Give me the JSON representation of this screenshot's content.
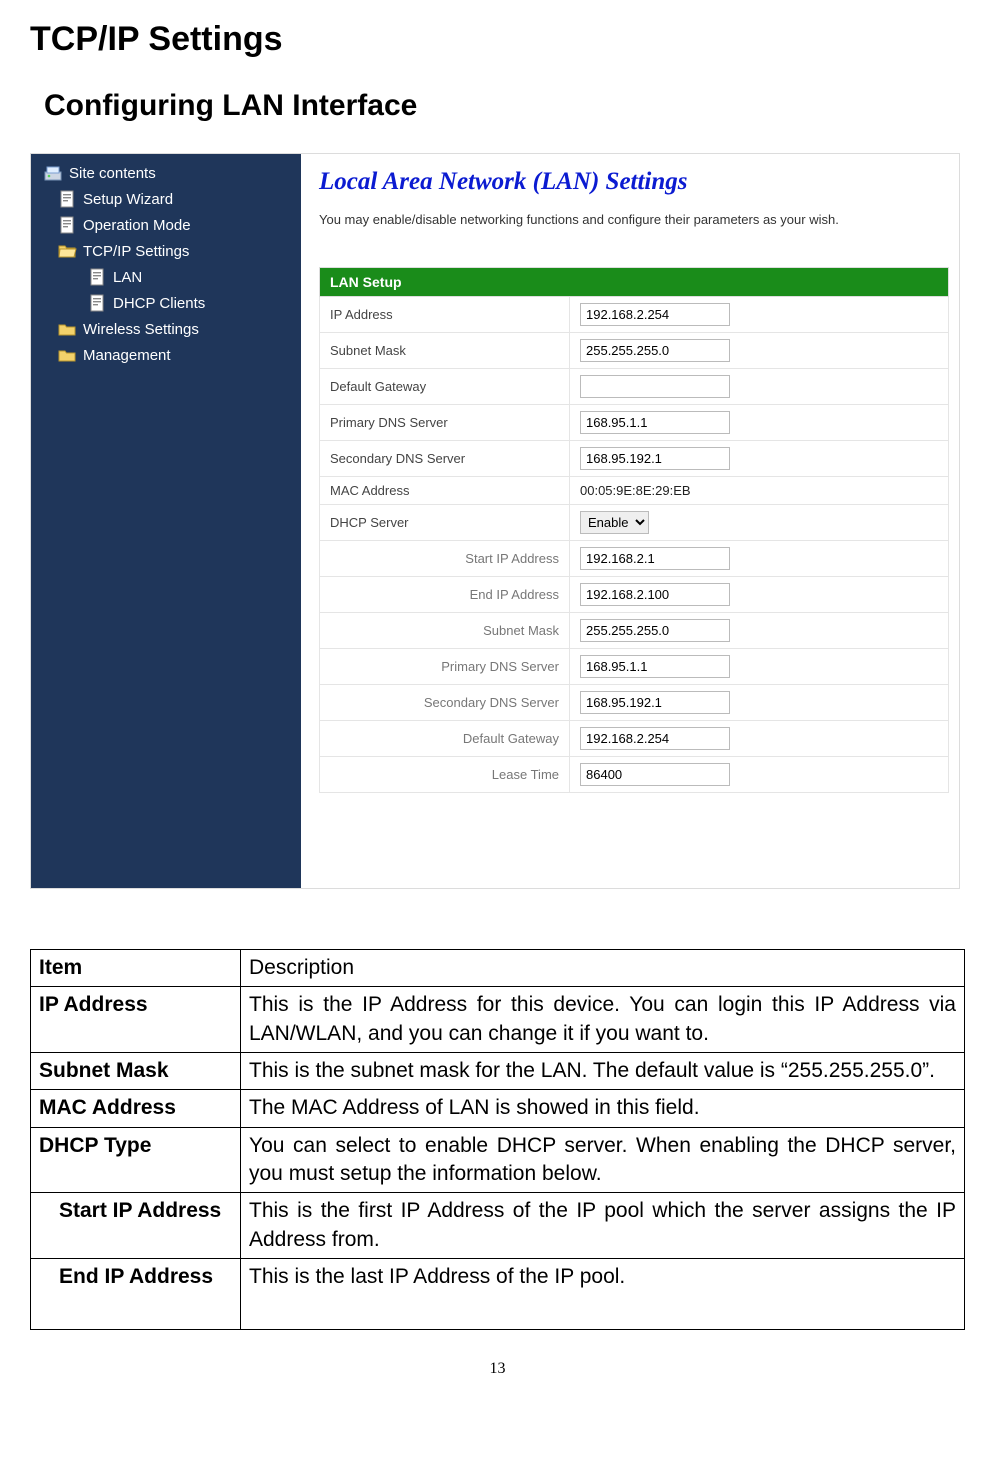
{
  "headings": {
    "h1": "TCP/IP Settings",
    "h2": "Configuring LAN Interface"
  },
  "sidebar": {
    "items": [
      {
        "name": "site-contents",
        "label": "Site contents",
        "icon": "site"
      },
      {
        "name": "setup-wizard",
        "label": "Setup Wizard",
        "icon": "page"
      },
      {
        "name": "operation-mode",
        "label": "Operation Mode",
        "icon": "page"
      },
      {
        "name": "tcpip-settings",
        "label": "TCP/IP Settings",
        "icon": "folder-open"
      },
      {
        "name": "lan",
        "label": "LAN",
        "icon": "page",
        "sub": true
      },
      {
        "name": "dhcp-clients",
        "label": "DHCP Clients",
        "icon": "page",
        "sub": true
      },
      {
        "name": "wireless-settings",
        "label": "Wireless Settings",
        "icon": "folder"
      },
      {
        "name": "management",
        "label": "Management",
        "icon": "folder"
      }
    ]
  },
  "content": {
    "title": "Local Area Network (LAN) Settings",
    "subtitle": "You may enable/disable networking functions and configure their parameters as your wish.",
    "group": "LAN Setup",
    "rows": {
      "ip_address": {
        "label": "IP Address",
        "value": "192.168.2.254"
      },
      "subnet_mask": {
        "label": "Subnet Mask",
        "value": "255.255.255.0"
      },
      "default_gateway": {
        "label": "Default Gateway",
        "value": ""
      },
      "primary_dns": {
        "label": "Primary DNS Server",
        "value": "168.95.1.1"
      },
      "secondary_dns": {
        "label": "Secondary DNS Server",
        "value": "168.95.192.1"
      },
      "mac_address": {
        "label": "MAC Address",
        "value": "00:05:9E:8E:29:EB"
      },
      "dhcp_server": {
        "label": "DHCP Server",
        "value": "Enable"
      },
      "start_ip": {
        "label": "Start IP Address",
        "value": "192.168.2.1"
      },
      "end_ip": {
        "label": "End IP Address",
        "value": "192.168.2.100"
      },
      "dhcp_subnet": {
        "label": "Subnet Mask",
        "value": "255.255.255.0"
      },
      "dhcp_primary_dns": {
        "label": "Primary DNS Server",
        "value": "168.95.1.1"
      },
      "dhcp_secondary_dns": {
        "label": "Secondary DNS Server",
        "value": "168.95.192.1"
      },
      "dhcp_gateway": {
        "label": "Default Gateway",
        "value": "192.168.2.254"
      },
      "lease_time": {
        "label": "Lease Time",
        "value": "86400"
      }
    }
  },
  "desc_table": {
    "header": {
      "item": "Item",
      "desc": "Description"
    },
    "rows": [
      {
        "item": "IP Address",
        "desc": "This is the IP Address for this device. You can login this IP Address via LAN/WLAN, and you can change it if you want to.",
        "indent": false
      },
      {
        "item": "Subnet Mask",
        "desc": "This is the subnet mask for the LAN. The default value is “255.255.255.0”.",
        "indent": false
      },
      {
        "item": "MAC Address",
        "desc": "The MAC Address of LAN is showed in this field.",
        "indent": false
      },
      {
        "item": "DHCP Type",
        "desc": "You can select to enable DHCP server. When enabling the DHCP server, you must setup the information below.",
        "indent": false
      },
      {
        "item": "Start IP Address",
        "desc": "This is the first IP Address of the IP pool which the server assigns the IP Address from.",
        "indent": true
      },
      {
        "item": "End IP Address",
        "desc": "This is the last IP Address of the IP pool.",
        "indent": true,
        "tall": true
      }
    ]
  },
  "page_num": "13"
}
